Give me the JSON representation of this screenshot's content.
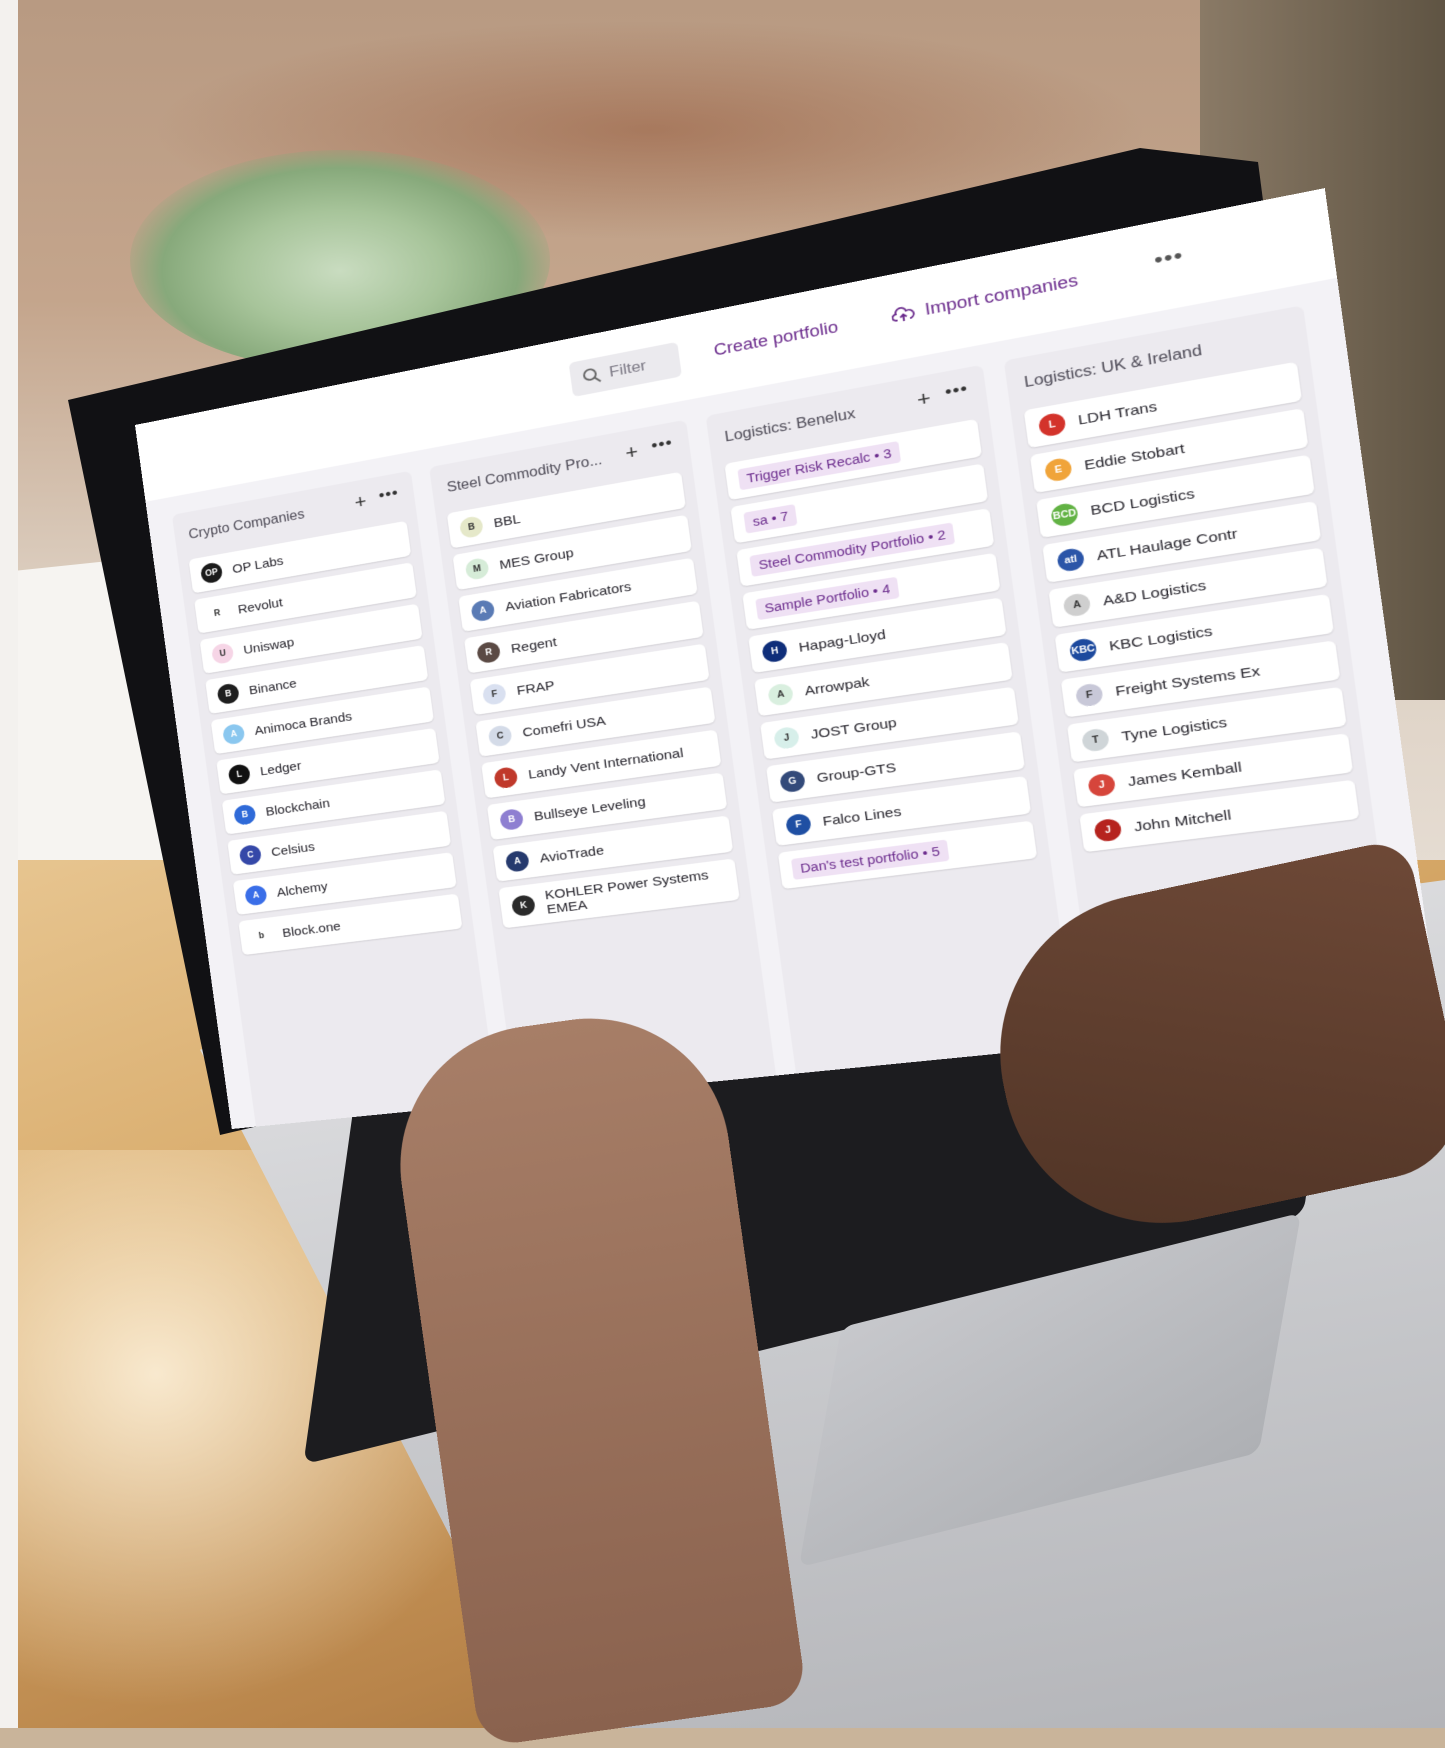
{
  "toolbar": {
    "filter_placeholder": "Filter",
    "create_label": "Create portfolio",
    "import_label": "Import companies",
    "more_label": "•••"
  },
  "colors": {
    "accent": "#6a2a8c",
    "tag_bg": "#efe1f4",
    "column_bg": "#eceaef"
  },
  "columns": [
    {
      "title": "Crypto Companies",
      "items": [
        {
          "name": "OP Labs",
          "logo": "OP",
          "color": "#1b1b1b"
        },
        {
          "name": "Revolut",
          "logo": "R",
          "color": "#ffffff"
        },
        {
          "name": "Uniswap",
          "logo": "U",
          "color": "#f6d5e6"
        },
        {
          "name": "Binance",
          "logo": "B",
          "color": "#1e1e1e"
        },
        {
          "name": "Animoca Brands",
          "logo": "A",
          "color": "#8ac7ef"
        },
        {
          "name": "Ledger",
          "logo": "L",
          "color": "#111111"
        },
        {
          "name": "Blockchain",
          "logo": "B",
          "color": "#2f6ad8"
        },
        {
          "name": "Celsius",
          "logo": "C",
          "color": "#3548a8"
        },
        {
          "name": "Alchemy",
          "logo": "A",
          "color": "#3a6ee8"
        },
        {
          "name": "Block.one",
          "logo": "b",
          "color": "#ffffff"
        }
      ]
    },
    {
      "title": "Steel Commodity Pro...",
      "items": [
        {
          "name": "BBL",
          "logo": "B",
          "color": "#e5e8c9"
        },
        {
          "name": "MES Group",
          "logo": "M",
          "color": "#d6ecd8"
        },
        {
          "name": "Aviation Fabricators",
          "logo": "A",
          "color": "#5a7bb5"
        },
        {
          "name": "Regent",
          "logo": "R",
          "color": "#5b4a44"
        },
        {
          "name": "FRAP",
          "logo": "F",
          "color": "#d9e0f0"
        },
        {
          "name": "Comefri USA",
          "logo": "C",
          "color": "#d4dbe8"
        },
        {
          "name": "Landy Vent International",
          "logo": "L",
          "color": "#c0392b"
        },
        {
          "name": "Bullseye Leveling",
          "logo": "B",
          "color": "#8e7fd1"
        },
        {
          "name": "AvioTrade",
          "logo": "A",
          "color": "#263a6e"
        },
        {
          "name": "KOHLER Power Systems EMEA",
          "logo": "K",
          "color": "#2a2a2a"
        }
      ]
    },
    {
      "title": "Logistics: Benelux",
      "tags": [
        "Trigger Risk Recalc • 3",
        "sa • 7",
        "Steel Commodity Portfolio • 2",
        "Sample Portfolio • 4"
      ],
      "items": [
        {
          "name": "Hapag-Lloyd",
          "logo": "H",
          "color": "#0f2e7a"
        },
        {
          "name": "Arrowpak",
          "logo": "A",
          "color": "#d9efdf"
        },
        {
          "name": "JOST Group",
          "logo": "J",
          "color": "#d7efea"
        },
        {
          "name": "Group-GTS",
          "logo": "G",
          "color": "#334a7a"
        },
        {
          "name": "Falco Lines",
          "logo": "F",
          "color": "#1f4fa3"
        }
      ],
      "tags_after": [
        "Dan's test portfolio • 5"
      ]
    },
    {
      "title": "Logistics: UK & Ireland",
      "items": [
        {
          "name": "LDH Trans",
          "logo": "L",
          "color": "#d3332b"
        },
        {
          "name": "Eddie Stobart",
          "logo": "E",
          "color": "#f0a43a"
        },
        {
          "name": "BCD Logistics",
          "logo": "BCD",
          "color": "#62b244"
        },
        {
          "name": "ATL Haulage Contr",
          "logo": "atl",
          "color": "#2b55a8"
        },
        {
          "name": "A&D Logistics",
          "logo": "A",
          "color": "#cfcfcf"
        },
        {
          "name": "KBC Logistics",
          "logo": "KBC",
          "color": "#1d4a9e"
        },
        {
          "name": "Freight Systems Ex",
          "logo": "F",
          "color": "#c8c8d8"
        },
        {
          "name": "Tyne Logistics",
          "logo": "T",
          "color": "#cfd5d8"
        },
        {
          "name": "James Kemball",
          "logo": "J",
          "color": "#d6453b"
        },
        {
          "name": "John Mitchell",
          "logo": "J",
          "color": "#b6231e"
        }
      ]
    }
  ]
}
